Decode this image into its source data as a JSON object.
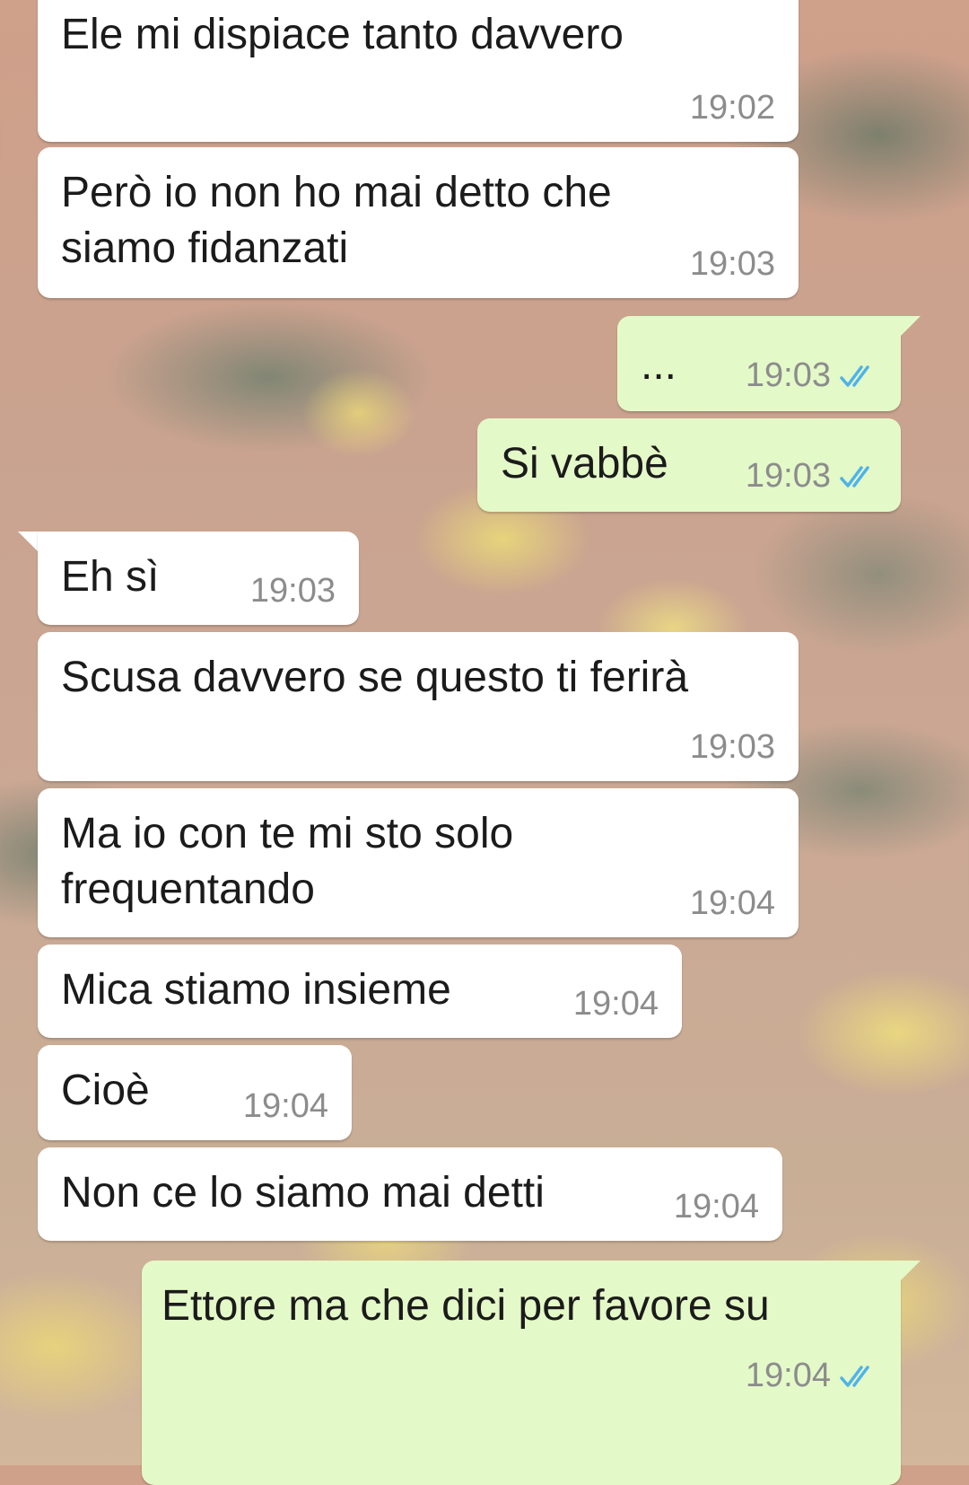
{
  "messages": [
    {
      "dir": "in",
      "text": "Ele mi dispiace tanto davvero",
      "time": "19:02"
    },
    {
      "dir": "in",
      "text": "Però io non ho mai detto che\nsiamo fidanzati",
      "time": "19:03"
    },
    {
      "dir": "out",
      "text": "...",
      "time": "19:03",
      "ticks": "read"
    },
    {
      "dir": "out",
      "text": "Si vabbè",
      "time": "19:03",
      "ticks": "read"
    },
    {
      "dir": "in",
      "text": "Eh sì",
      "time": "19:03"
    },
    {
      "dir": "in",
      "text": "Scusa davvero se questo ti ferirà",
      "time": "19:03"
    },
    {
      "dir": "in",
      "text": "Ma io con te mi sto solo\nfrequentando",
      "time": "19:04"
    },
    {
      "dir": "in",
      "text": "Mica stiamo insieme",
      "time": "19:04"
    },
    {
      "dir": "in",
      "text": "Cioè",
      "time": "19:04"
    },
    {
      "dir": "in",
      "text": "Non ce lo siamo mai detti",
      "time": "19:04"
    },
    {
      "dir": "out",
      "text": "Ettore ma che dici per favore su",
      "time": "19:04",
      "ticks": "read"
    }
  ],
  "colors": {
    "incoming": "#ffffff",
    "outgoing": "#e4f9c8",
    "read_ticks": "#4fb3e8",
    "time": "#8c8c8c"
  }
}
